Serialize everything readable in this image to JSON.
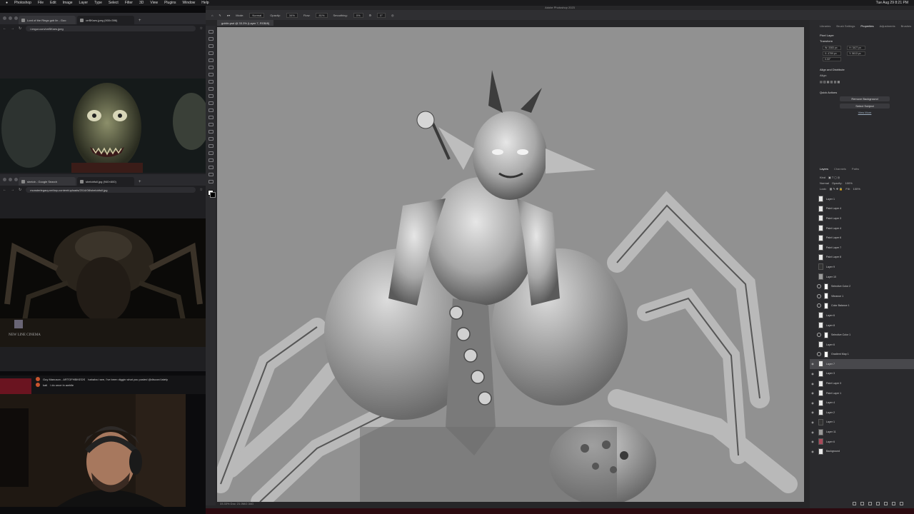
{
  "menubar": {
    "items": [
      "Photoshop",
      "File",
      "Edit",
      "Image",
      "Layer",
      "Type",
      "Select",
      "Filter",
      "3D",
      "View",
      "Plugins",
      "Window",
      "Help"
    ],
    "clock": "Tue Aug 29  8:21 PM"
  },
  "browser1": {
    "tabs": [
      "Lord of the Rings gob lin - Goo",
      "xrrBKses.jpeg (900×396)"
    ],
    "url": "i.imgur.com/xrrBKses.jpeg"
  },
  "browser2": {
    "tabs": [
      "shelob - Google Search",
      "shelobfull.jpg (940×600)"
    ],
    "url": "monsterlegacy.net/wp-content/uploads/2014/08/shelobfull.jpg",
    "watermark": "NEW LINE CINEMA"
  },
  "chat": {
    "line1_user": "Guy Manuson - ARTOFHBIKEDS",
    "line1_text": "hahaha i see, I've been diggin what you posted @discord lately",
    "line2_user": "kati",
    "line2_text": "i do once in awhile"
  },
  "photoshop": {
    "title": "Adobe Photoshop 2023",
    "doc_tab": "goblin.psd @ 33.3% (Layer 7, RGB/8)",
    "options": {
      "mode_label": "Mode:",
      "mode": "Normal",
      "opacity_label": "Opacity:",
      "opacity": "34%",
      "flow_label": "Flow:",
      "flow": "81%",
      "smoothing_label": "Smoothing:",
      "smoothing": "0%",
      "angle": "0°"
    },
    "status": "33.33%   Doc: 21.0M/2.34G"
  },
  "panels": {
    "tabs": [
      "Libraries",
      "Brush Settings",
      "Properties",
      "Adjustments",
      "Brushes"
    ],
    "props_title": "Pixel Layer",
    "transform_label": "Transform",
    "w": "W: 3383 px",
    "h": "H: 3427 px",
    "x": "X: 4799 px",
    "y": "Y: 5613 px",
    "angle": "0.00°",
    "align_label": "Align and Distribute",
    "align_sub": "Align:",
    "quick_label": "Quick Actions",
    "remove_bg": "Remove Background",
    "select_subject": "Select Subject",
    "view_more": "View More",
    "layer_tabs": [
      "Layers",
      "Channels",
      "Paths"
    ],
    "kind": "Kind",
    "blend": "Normal",
    "opacity_label": "Opacity:",
    "opacity": "100%",
    "fill_label": "Fill:",
    "fill": "100%",
    "lock_label": "Lock:"
  },
  "layers": [
    {
      "name": "Layer 1",
      "kind": "pixel",
      "visible": false
    },
    {
      "name": "Paint Layer 4",
      "kind": "pixel",
      "visible": false
    },
    {
      "name": "Paint Layer 3",
      "kind": "pixel",
      "visible": false
    },
    {
      "name": "Paint Layer 4",
      "kind": "pixel",
      "visible": false
    },
    {
      "name": "Paint Layer 6",
      "kind": "pixel",
      "visible": false
    },
    {
      "name": "Paint Layer 7",
      "kind": "pixel",
      "visible": false
    },
    {
      "name": "Paint Layer 8",
      "kind": "pixel",
      "visible": false
    },
    {
      "name": "Layer 9",
      "kind": "blk",
      "visible": false
    },
    {
      "name": "Layer 10",
      "kind": "gray",
      "visible": false
    },
    {
      "name": "Selective Color 2",
      "kind": "adj",
      "visible": false
    },
    {
      "name": "Vibrance 1",
      "kind": "adj",
      "visible": false
    },
    {
      "name": "Color Balance 1",
      "kind": "adj",
      "visible": false
    },
    {
      "name": "Layer 6",
      "kind": "pixel",
      "visible": false
    },
    {
      "name": "Layer 8",
      "kind": "pixel",
      "visible": false
    },
    {
      "name": "Selective Color 1",
      "kind": "adj",
      "visible": false
    },
    {
      "name": "Layer 6",
      "kind": "pixel",
      "visible": false
    },
    {
      "name": "Gradient Map 1",
      "kind": "adj",
      "visible": false
    },
    {
      "name": "Layer 7",
      "kind": "pixel",
      "visible": true,
      "selected": true
    },
    {
      "name": "Layer 3",
      "kind": "pixel",
      "visible": true
    },
    {
      "name": "Paint Layer 3",
      "kind": "pixel",
      "visible": true
    },
    {
      "name": "Paint Layer 1",
      "kind": "pixel",
      "visible": true
    },
    {
      "name": "Layer 4",
      "kind": "pixel",
      "visible": true
    },
    {
      "name": "Layer 2",
      "kind": "pixel",
      "visible": true
    },
    {
      "name": "Layer 1",
      "kind": "blk",
      "visible": true
    },
    {
      "name": "Layer 11",
      "kind": "gray",
      "visible": true
    },
    {
      "name": "Layer 6",
      "kind": "red",
      "visible": true
    },
    {
      "name": "Background",
      "kind": "pixel",
      "visible": true
    }
  ],
  "colors": {
    "accent": "#2b6fd6",
    "canvas": "#919191"
  }
}
